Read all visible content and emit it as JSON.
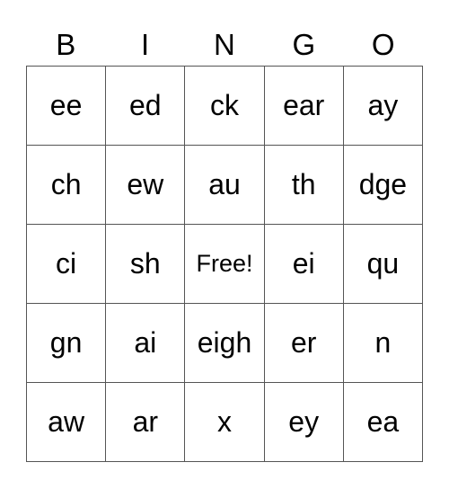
{
  "header": [
    "B",
    "I",
    "N",
    "G",
    "O"
  ],
  "rows": [
    [
      "ee",
      "ed",
      "ck",
      "ear",
      "ay"
    ],
    [
      "ch",
      "ew",
      "au",
      "th",
      "dge"
    ],
    [
      "ci",
      "sh",
      "Free!",
      "ei",
      "qu"
    ],
    [
      "gn",
      "ai",
      "eigh",
      "er",
      "n"
    ],
    [
      "aw",
      "ar",
      "x",
      "ey",
      "ea"
    ]
  ]
}
